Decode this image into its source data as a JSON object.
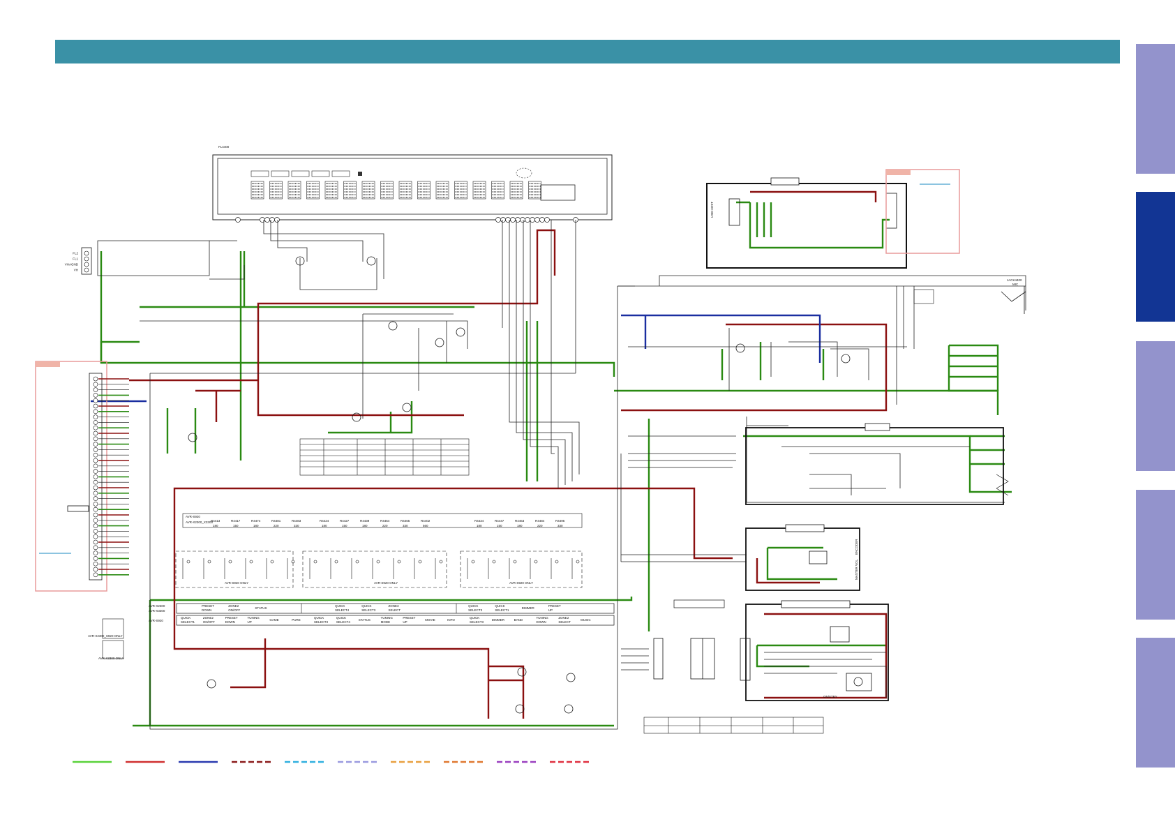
{
  "colors": {
    "banner": "#3a91a6",
    "tab": "#9393cc",
    "tab_active": "#123594",
    "green": "#2a8a12",
    "red": "#8b1010",
    "blue": "#1a2ea0",
    "pink": "#e99a9a"
  },
  "side_tabs": [
    {
      "state": "normal"
    },
    {
      "state": "active"
    },
    {
      "state": "normal"
    },
    {
      "state": "normal"
    },
    {
      "state": "normal"
    }
  ],
  "fl": {
    "ref": "FL4400"
  },
  "connector_pins": [
    "FL2",
    "FL1",
    "VHAGND",
    "VH"
  ],
  "usb_label": "USB HOST",
  "jack_label": "JACK4400",
  "jack_sub": "MIC",
  "encoder_labels": [
    "MASTER VOL.",
    "ENCODER"
  ],
  "power_sw": "ON/STBY",
  "matrix": {
    "model1_head": "AVR-S920",
    "model2_head": "AVR-X2300_X3300",
    "group1": {
      "refs": [
        "R4413",
        "R4417",
        "R4474",
        "R4481",
        "R4483"
      ],
      "vals": [
        "180",
        "150",
        "180",
        "220",
        "330"
      ]
    },
    "group2": {
      "refs": [
        "R4424",
        "R4427",
        "R4439",
        "R4464",
        "R4465",
        "R4402"
      ],
      "vals": [
        "180",
        "150",
        "180",
        "220",
        "330",
        "560"
      ]
    },
    "group3": {
      "refs": [
        "R4434",
        "R4447",
        "R4463",
        "R4484",
        "R4495"
      ],
      "vals": [
        "180",
        "150",
        "180",
        "220",
        "330"
      ]
    },
    "only_label": "AVR-S920 ONLY"
  },
  "func_table": {
    "row1_model": [
      "AVR-X2300",
      "AVR-X3300"
    ],
    "row2_model": "AVR-S920",
    "row1": [
      "PRESET DOWN",
      "ZONE2 ON/OFF",
      "STATUS",
      "",
      "",
      "QUICK SELECT4",
      "QUICK SELECT3",
      "ZONE3 SELECT",
      "",
      "",
      "QUICK SELECT3",
      "QUICK SELECT1",
      "DIMMER",
      "PRESET UP"
    ],
    "row2": [
      "QUICK SELECT1",
      "ZONE2 ON/OFF",
      "PRESET DOWN",
      "TUNING UP",
      "GAME",
      "PURE",
      "QUICK SELECT3",
      "QUICK SELECT4",
      "STATUS",
      "TUNING MODE",
      "PRESET UP",
      "MOVIE",
      "INFO",
      "QUICK SELECT3",
      "DIMMER",
      "BAND",
      "TUNING DOWN",
      "ZONE2 SELECT",
      "MUSIC"
    ]
  },
  "switch_labels": [
    "AVR-X2300_S920 ONLY",
    "AVR-X3300 ONLY"
  ],
  "legend": [
    {
      "color": "#5ad23a",
      "style": "solid"
    },
    {
      "color": "#d03030",
      "style": "solid"
    },
    {
      "color": "#2a3ab0",
      "style": "solid"
    },
    {
      "color": "#8b1a1a",
      "style": "dashed"
    },
    {
      "color": "#30b0e0",
      "style": "dashed"
    },
    {
      "color": "#9a9ae0",
      "style": "dashed"
    },
    {
      "color": "#e8a040",
      "style": "dashed"
    },
    {
      "color": "#e07830",
      "style": "dashed"
    },
    {
      "color": "#9a40c0",
      "style": "dashed"
    },
    {
      "color": "#e03040",
      "style": "dashed"
    }
  ]
}
